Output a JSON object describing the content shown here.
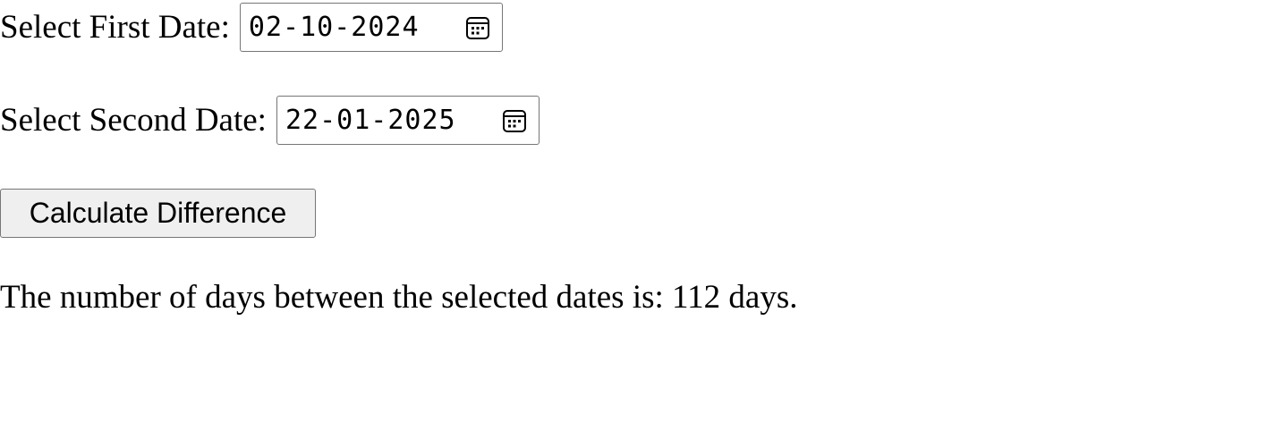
{
  "form": {
    "first_date": {
      "label": "Select First Date:",
      "value": "02-10-2024",
      "icon": "calendar-icon"
    },
    "second_date": {
      "label": "Select Second Date:",
      "value": "22-01-2025",
      "icon": "calendar-icon"
    },
    "calculate_button_label": "Calculate Difference"
  },
  "result": {
    "text": "The number of days between the selected dates is: 112 days."
  }
}
